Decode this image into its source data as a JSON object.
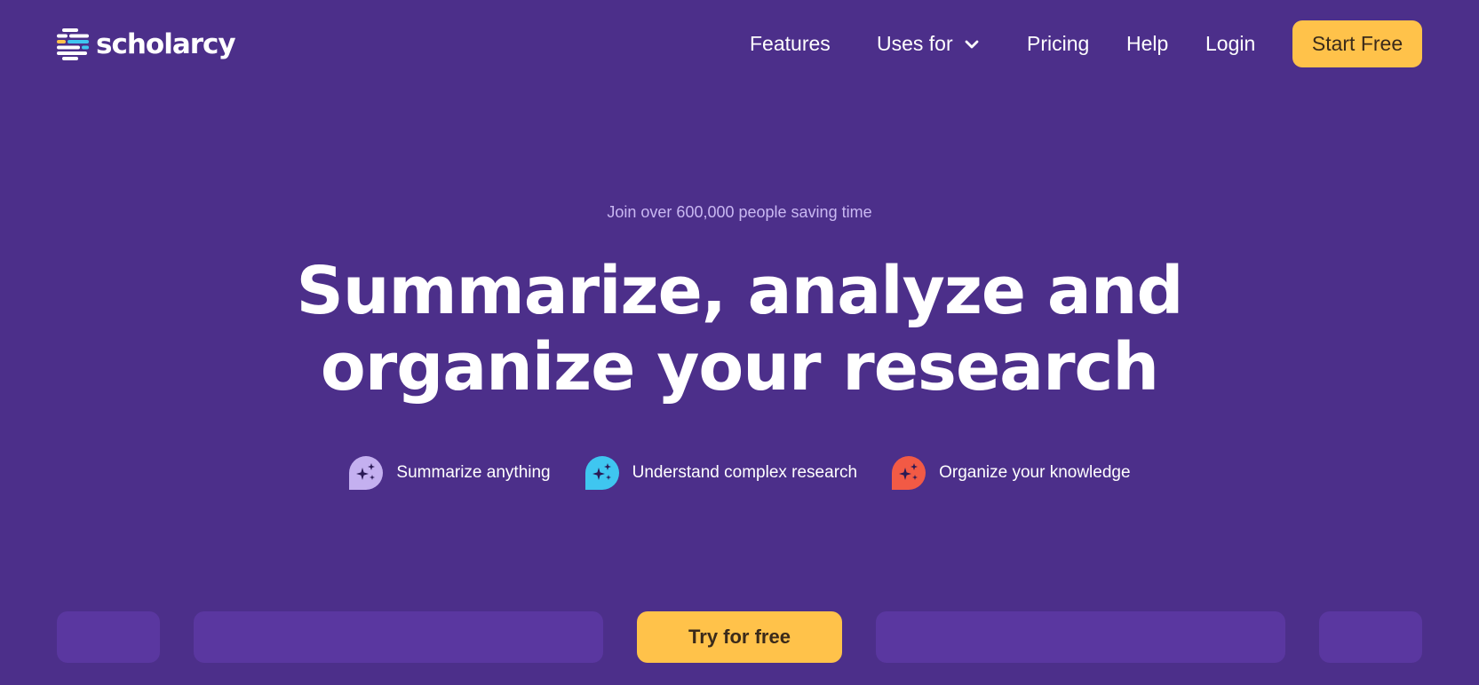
{
  "header": {
    "logo_text": "scholarcy",
    "nav": {
      "features": "Features",
      "uses_for": "Uses for",
      "pricing": "Pricing",
      "help": "Help",
      "login": "Login"
    },
    "cta": "Start Free"
  },
  "hero": {
    "tagline": "Join over 600,000 people saving time",
    "headline_line1": "Summarize, analyze and",
    "headline_line2": "organize your research",
    "features": [
      {
        "label": "Summarize anything",
        "icon": "sparkle-chat-icon",
        "color": "#c4b0f0"
      },
      {
        "label": "Understand complex research",
        "icon": "sparkle-chat-icon",
        "color": "#3fc6f0"
      },
      {
        "label": "Organize your knowledge",
        "icon": "sparkle-chat-icon",
        "color": "#f25a45"
      }
    ]
  },
  "bottom": {
    "cta": "Try for free"
  },
  "colors": {
    "background": "#4c2f8a",
    "accent": "#ffc24a",
    "tile": "#5a37a0"
  }
}
